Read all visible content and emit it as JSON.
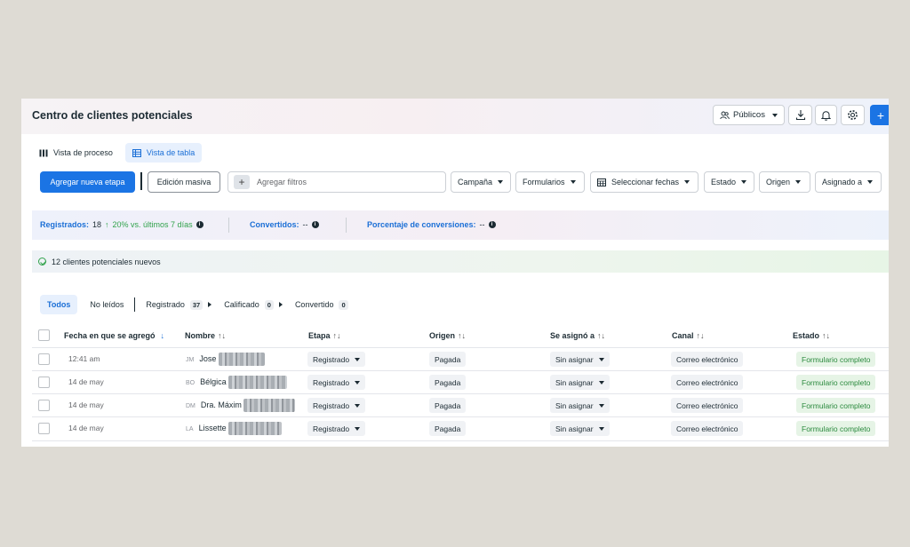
{
  "header": {
    "title": "Centro de clientes potenciales",
    "audiences_label": "Públicos",
    "add_icon": "+"
  },
  "views": [
    {
      "label": "Vista de proceso",
      "icon": "columns-icon",
      "active": false
    },
    {
      "label": "Vista de tabla",
      "icon": "table-icon",
      "active": true
    }
  ],
  "toolbar": {
    "add_stage_label": "Agregar nueva etapa",
    "bulk_edit_label": "Edición masiva",
    "filter_plus": "+",
    "filter_placeholder": "Agregar filtros",
    "dropdowns": [
      "Campaña",
      "Formularios",
      "Seleccionar fechas",
      "Estado",
      "Origen",
      "Asignado a"
    ]
  },
  "stats": {
    "registered_label": "Registrados:",
    "registered_value": "18",
    "registered_arrow": "↑",
    "registered_change": "20% vs. últimos 7 días",
    "converted_label": "Convertidos:",
    "converted_value": "--",
    "conversion_rate_label": "Porcentaje de conversiones:",
    "conversion_rate_value": "--"
  },
  "banner": {
    "text": "12 clientes potenciales nuevos"
  },
  "stage_tabs": {
    "all": "Todos",
    "unread": "No leídos",
    "stages": [
      {
        "label": "Registrado",
        "count": "37"
      },
      {
        "label": "Calificado",
        "count": "0"
      },
      {
        "label": "Convertido",
        "count": "0"
      }
    ]
  },
  "table": {
    "columns": {
      "date": "Fecha en que se agregó",
      "date_sort": "↓",
      "name": "Nombre",
      "stage": "Etapa",
      "origin": "Origen",
      "assigned": "Se asignó a",
      "channel": "Canal",
      "status": "Estado",
      "sort_icon": "↑↓"
    },
    "rows": [
      {
        "date": "12:41 am",
        "initials": "JM",
        "name": "Jose",
        "stage": "Registrado",
        "origin": "Pagada",
        "assigned": "Sin asignar",
        "channel": "Correo electrónico",
        "status": "Formulario completo"
      },
      {
        "date": "14 de may",
        "initials": "BO",
        "name": "Bélgica",
        "stage": "Registrado",
        "origin": "Pagada",
        "assigned": "Sin asignar",
        "channel": "Correo electrónico",
        "status": "Formulario completo"
      },
      {
        "date": "14 de may",
        "initials": "DM",
        "name": "Dra. Máxim",
        "stage": "Registrado",
        "origin": "Pagada",
        "assigned": "Sin asignar",
        "channel": "Correo electrónico",
        "status": "Formulario completo"
      },
      {
        "date": "14 de may",
        "initials": "LA",
        "name": "Lissette",
        "stage": "Registrado",
        "origin": "Pagada",
        "assigned": "Sin asignar",
        "channel": "Correo electrónico",
        "status": "Formulario completo"
      }
    ]
  },
  "colors": {
    "accent": "#1b74e4",
    "success": "#31a24c",
    "background": "#dedbd4"
  }
}
